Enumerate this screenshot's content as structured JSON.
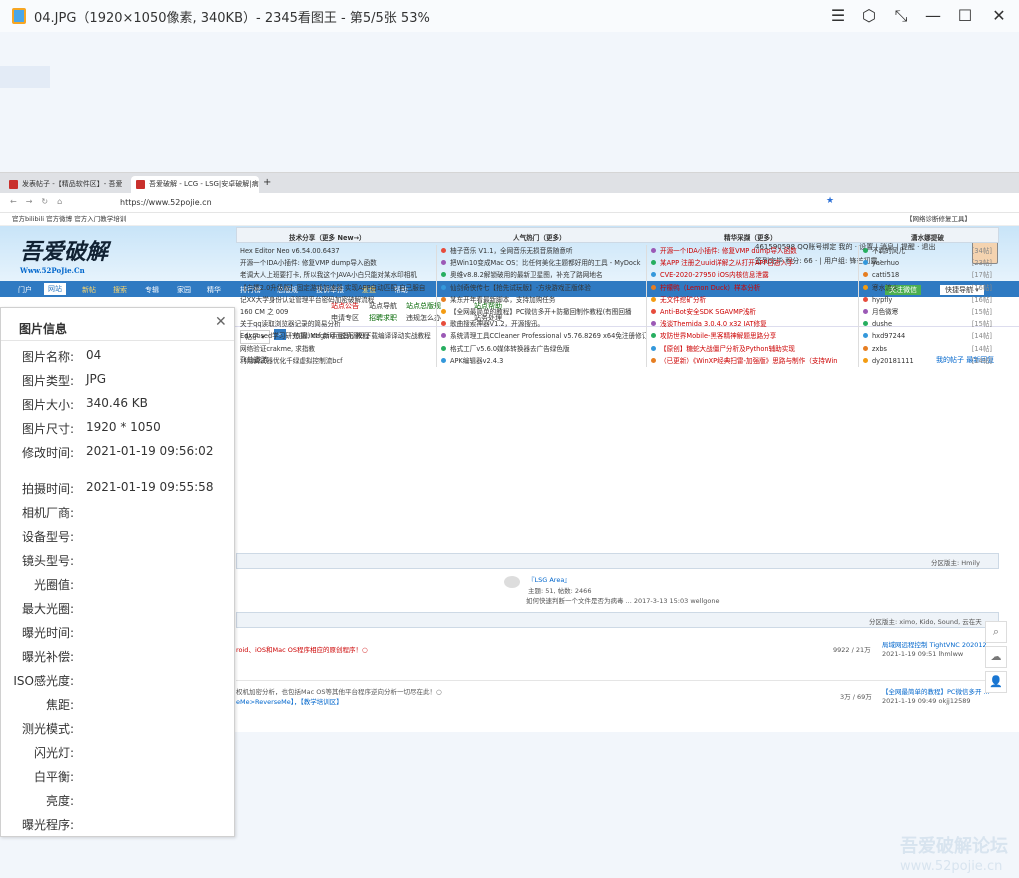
{
  "window": {
    "title": "04.JPG（1920×1050像素, 340KB）- 2345看图王 - 第5/5张 53%",
    "controls": [
      "☰",
      "⬡",
      "⤡",
      "—",
      "☐",
      "✕"
    ]
  },
  "browser": {
    "tabs": [
      {
        "label": "发表帖子 -【精品软件区】- 吾爱"
      },
      {
        "label": "吾爱破解 - LCG - LSG|安卓破解|病"
      }
    ],
    "url": "https://www.52pojie.cn",
    "bookmarks": "官方bilibili  官方微博  官方入门教学培训",
    "right_tool": "【网络诊断修复工具】"
  },
  "site": {
    "logo": "吾爱破解",
    "logo_sub": "Www.52PoJie.Cn",
    "user": "461590598  QQ账号绑定  我的 · 设置 | 消息 | 提醒 · 退出",
    "user2": "签到完毕  积分: 66 · | 用户组: 锋芒初露 ·",
    "nav": [
      "门户",
      "网站",
      "新帖",
      "搜索",
      "专辑",
      "家园",
      "精华",
      "排行榜",
      "总版规",
      "投诉举报",
      "爱盘",
      "帮助"
    ],
    "nav_right": "关注微信",
    "nav_quick": "快捷导航 ▾",
    "subnav": [
      "站点公告",
      "站点导航",
      "站点总版规",
      "站点帮助",
      "申请专区",
      "招聘求职",
      "违规怎么办",
      "站务处理"
    ],
    "hot": "热搜: ctf 新手 脱壳 教程",
    "mine": "我的帖子  最新回复",
    "flyline": "飞仙遨游"
  },
  "columns": [
    {
      "title": "技术分享（更多 New→）",
      "items": [
        "Hex Editor Neo v6.54.00.6437",
        "开源一个IDA小插件: 修复VMP dump导入函数",
        "老调大人上班要打卡, 所以我这个JAVA小白只能对某水印相机",
        "【白嫖2.0升级版】固定游戏加速器 实现APP自动匹配 自己服自",
        "记XX大学身份认证管理平台密码加密破解流程",
        "160 CM 之 009",
        "关于qq读取浏览器记录的简易分析",
        "Edxposed学习研究(四)Magisk(面具)源码下载编译译动实战教程",
        "网络验证crakme, 求指教",
        "利用调试器优化千绿虚拟控制流bcf"
      ]
    },
    {
      "title": "人气热门（更多）",
      "items": [
        "柚子音乐 V1.1，全网音乐无损音质随意听",
        "把Win10变成Mac OS：比任何美化主题都好用的工具 - MyDock",
        "奥维v8.8.2解锁破用的最新卫星图，补充了路网地名",
        "仙剑奇侠传七【抢先试玩版】-方块游戏正版体验",
        "某东开年看最新脚本，支持加购任务",
        "【全网最简单的教程】PC微信多开+防撤回制作教程(有图回播",
        "歌曲搜索神器V1.2，开源搜迅。",
        "系统清理工具CCleaner Professional v5.76.8269 x64免注册修订",
        "格式工厂v5.6.0媒体转换器去广告绿色版",
        "APK编辑器v2.4.3"
      ]
    },
    {
      "title": "精华采撷（更多）",
      "items": [
        "开源一个IDA小插件: 修复VMP dump导入函数",
        "某APP 注册之uuid详解之从打开APP日志入手",
        "CVE-2020-27950 iOS内核信息泄露",
        "柠檬鸭（Lemon Duck）样本分析",
        "无文件挖矿分析",
        "Anti-Bot安全SDK SGAVMP浅析",
        "浅谈Themida 3.0.4.0 x32 IAT修复",
        "攻防世界Mobile-黑客精神解题思路分享",
        "【原创】糖蛇大战僵尸分析及Python辅助实现",
        "（已更新）《WinXP经典扫雷-加强版》思路与制作（支持Win"
      ]
    },
    {
      "title": "潇水娜提破",
      "items": [
        "不羁的风儿",
        "yaerhuo",
        "catti518",
        "寒水流火",
        "hypfly",
        "月色微寒",
        "dushe",
        "hxd97244",
        "zxbs",
        "dy20181111"
      ],
      "counts": [
        "[34帖]",
        "[23帖]",
        "[17帖]",
        "[16帖]",
        "[16帖]",
        "[15帖]",
        "[15帖]",
        "[14帖]",
        "[14帖]",
        "[14帖]"
      ]
    }
  ],
  "sections": {
    "lsg_moderator": "分区版主: Hmily",
    "lsg_title": "『LSG Area』",
    "lsg_stats": "主题: 51, 帖数: 2466",
    "lsg_last": "如何快速判断一个文件是否为病毒 ... 2017-3-13 15:03 wellgone",
    "mod2": "分区版主: ximo, Kido, Sound, 云在天",
    "row1_desc": "roid、iOS和Mac OS程序相应的原创程序！○",
    "row1_count": "9922 / 21万",
    "row1_last": "局域网远程控制 TightVNC 202012 ...",
    "row1_time": "2021-1-19 09:51 lhmlww",
    "row2_desc": "权机加密分析，也包括Mac OS等其他平台程序逆向分析一切尽在此！○",
    "row2_desc2": "eMe>ReverseMe】，【教学培训区】",
    "row2_count": "3万 / 69万",
    "row2_last": "【全网最简单的教程】PC微信多开 ...",
    "row2_time": "2021-1-19 09:49 okjj12589"
  },
  "info_panel": {
    "title": "图片信息",
    "fields": [
      {
        "k": "图片名称:",
        "v": "04"
      },
      {
        "k": "图片类型:",
        "v": "JPG"
      },
      {
        "k": "图片大小:",
        "v": "340.46 KB"
      },
      {
        "k": "图片尺寸:",
        "v": "1920 * 1050"
      },
      {
        "k": "修改时间:",
        "v": "2021-01-19 09:56:02"
      },
      {
        "k": "拍摄时间:",
        "v": "2021-01-19 09:55:58"
      },
      {
        "k": "相机厂商:",
        "v": ""
      },
      {
        "k": "设备型号:",
        "v": ""
      },
      {
        "k": "镜头型号:",
        "v": ""
      },
      {
        "k": "光圈值:",
        "v": ""
      },
      {
        "k": "最大光圈:",
        "v": ""
      },
      {
        "k": "曝光时间:",
        "v": ""
      },
      {
        "k": "曝光补偿:",
        "v": ""
      },
      {
        "k": "ISO感光度:",
        "v": ""
      },
      {
        "k": "焦距:",
        "v": ""
      },
      {
        "k": "测光模式:",
        "v": ""
      },
      {
        "k": "闪光灯:",
        "v": ""
      },
      {
        "k": "白平衡:",
        "v": ""
      },
      {
        "k": "亮度:",
        "v": ""
      },
      {
        "k": "曝光程序:",
        "v": ""
      }
    ]
  },
  "watermark": {
    "line1": "吾爱破解论坛",
    "line2": "www.52pojie.cn"
  }
}
